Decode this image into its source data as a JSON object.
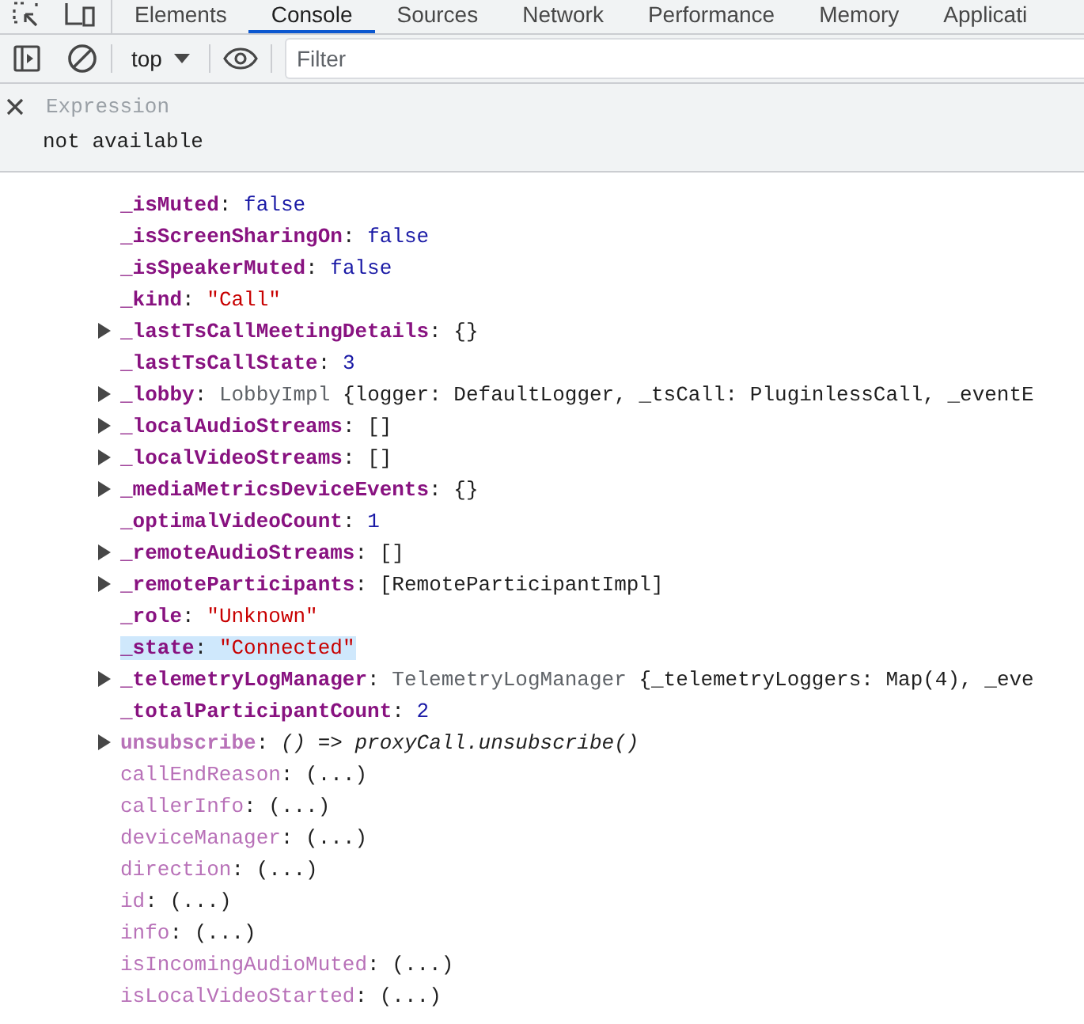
{
  "tabs": [
    {
      "label": "Elements",
      "selected": false
    },
    {
      "label": "Console",
      "selected": true
    },
    {
      "label": "Sources",
      "selected": false
    },
    {
      "label": "Network",
      "selected": false
    },
    {
      "label": "Performance",
      "selected": false
    },
    {
      "label": "Memory",
      "selected": false
    },
    {
      "label": "Applicati",
      "selected": false
    }
  ],
  "toolbar": {
    "context": "top",
    "filter": {
      "placeholder": "Filter"
    }
  },
  "watch": {
    "expression": {
      "placeholder": "Expression"
    },
    "result": "not available"
  },
  "properties": [
    {
      "key": "_isMuted",
      "separator": ":",
      "enumerable": true,
      "accessor": false,
      "kind": "boolean",
      "value": "false",
      "expandable": false,
      "selected": false
    },
    {
      "key": "_isScreenSharingOn",
      "separator": ":",
      "enumerable": true,
      "accessor": false,
      "kind": "boolean",
      "value": "false",
      "expandable": false,
      "selected": false
    },
    {
      "key": "_isSpeakerMuted",
      "separator": ":",
      "enumerable": true,
      "accessor": false,
      "kind": "boolean",
      "value": "false",
      "expandable": false,
      "selected": false
    },
    {
      "key": "_kind",
      "separator": ":",
      "enumerable": true,
      "accessor": false,
      "kind": "string",
      "value": "\"Call\"",
      "expandable": false,
      "selected": false
    },
    {
      "key": "_lastTsCallMeetingDetails",
      "separator": ":",
      "enumerable": true,
      "accessor": false,
      "kind": "object",
      "value": "{}",
      "expandable": true,
      "selected": false
    },
    {
      "key": "_lastTsCallState",
      "separator": ":",
      "enumerable": true,
      "accessor": false,
      "kind": "number",
      "value": "3",
      "expandable": false,
      "selected": false
    },
    {
      "key": "_lobby",
      "separator": ":",
      "enumerable": true,
      "accessor": false,
      "kind": "instance",
      "class_name": "LobbyImpl",
      "value": "{logger: DefaultLogger, _tsCall: PluginlessCall, _eventE",
      "expandable": true,
      "selected": false
    },
    {
      "key": "_localAudioStreams",
      "separator": ":",
      "enumerable": true,
      "accessor": false,
      "kind": "object",
      "value": "[]",
      "expandable": true,
      "selected": false
    },
    {
      "key": "_localVideoStreams",
      "separator": ":",
      "enumerable": true,
      "accessor": false,
      "kind": "object",
      "value": "[]",
      "expandable": true,
      "selected": false
    },
    {
      "key": "_mediaMetricsDeviceEvents",
      "separator": ":",
      "enumerable": true,
      "accessor": false,
      "kind": "object",
      "value": "{}",
      "expandable": true,
      "selected": false
    },
    {
      "key": "_optimalVideoCount",
      "separator": ":",
      "enumerable": true,
      "accessor": false,
      "kind": "number",
      "value": "1",
      "expandable": false,
      "selected": false
    },
    {
      "key": "_remoteAudioStreams",
      "separator": ":",
      "enumerable": true,
      "accessor": false,
      "kind": "object",
      "value": "[]",
      "expandable": true,
      "selected": false
    },
    {
      "key": "_remoteParticipants",
      "separator": ":",
      "enumerable": true,
      "accessor": false,
      "kind": "object",
      "value": "[RemoteParticipantImpl]",
      "expandable": true,
      "selected": false
    },
    {
      "key": "_role",
      "separator": ":",
      "enumerable": true,
      "accessor": false,
      "kind": "string",
      "value": "\"Unknown\"",
      "expandable": false,
      "selected": false
    },
    {
      "key": "_state",
      "separator": ":",
      "enumerable": true,
      "accessor": false,
      "kind": "string",
      "value": "\"Connected\"",
      "expandable": false,
      "selected": true
    },
    {
      "key": "_telemetryLogManager",
      "separator": ":",
      "enumerable": true,
      "accessor": false,
      "kind": "instance",
      "class_name": "TelemetryLogManager",
      "value": "{_telemetryLoggers: Map(4), _eve",
      "expandable": true,
      "selected": false
    },
    {
      "key": "_totalParticipantCount",
      "separator": ":",
      "enumerable": true,
      "accessor": false,
      "kind": "number",
      "value": "2",
      "expandable": false,
      "selected": false
    },
    {
      "key": "unsubscribe",
      "separator": ":",
      "enumerable": false,
      "accessor": false,
      "kind": "function",
      "value": "() => proxyCall.unsubscribe()",
      "expandable": true,
      "selected": false
    },
    {
      "key": "callEndReason",
      "separator": ":",
      "enumerable": false,
      "accessor": true,
      "kind": "getter",
      "value": "(...)",
      "expandable": false,
      "selected": false
    },
    {
      "key": "callerInfo",
      "separator": ":",
      "enumerable": false,
      "accessor": true,
      "kind": "getter",
      "value": "(...)",
      "expandable": false,
      "selected": false
    },
    {
      "key": "deviceManager",
      "separator": ":",
      "enumerable": false,
      "accessor": true,
      "kind": "getter",
      "value": "(...)",
      "expandable": false,
      "selected": false
    },
    {
      "key": "direction",
      "separator": ":",
      "enumerable": false,
      "accessor": true,
      "kind": "getter",
      "value": "(...)",
      "expandable": false,
      "selected": false
    },
    {
      "key": "id",
      "separator": ":",
      "enumerable": false,
      "accessor": true,
      "kind": "getter",
      "value": "(...)",
      "expandable": false,
      "selected": false
    },
    {
      "key": "info",
      "separator": ":",
      "enumerable": false,
      "accessor": true,
      "kind": "getter",
      "value": "(...)",
      "expandable": false,
      "selected": false
    },
    {
      "key": "isIncomingAudioMuted",
      "separator": ":",
      "enumerable": false,
      "accessor": true,
      "kind": "getter",
      "value": "(...)",
      "expandable": false,
      "selected": false
    },
    {
      "key": "isLocalVideoStarted",
      "separator": ":",
      "enumerable": false,
      "accessor": true,
      "kind": "getter",
      "value": "(...)",
      "expandable": false,
      "selected": false
    }
  ]
}
